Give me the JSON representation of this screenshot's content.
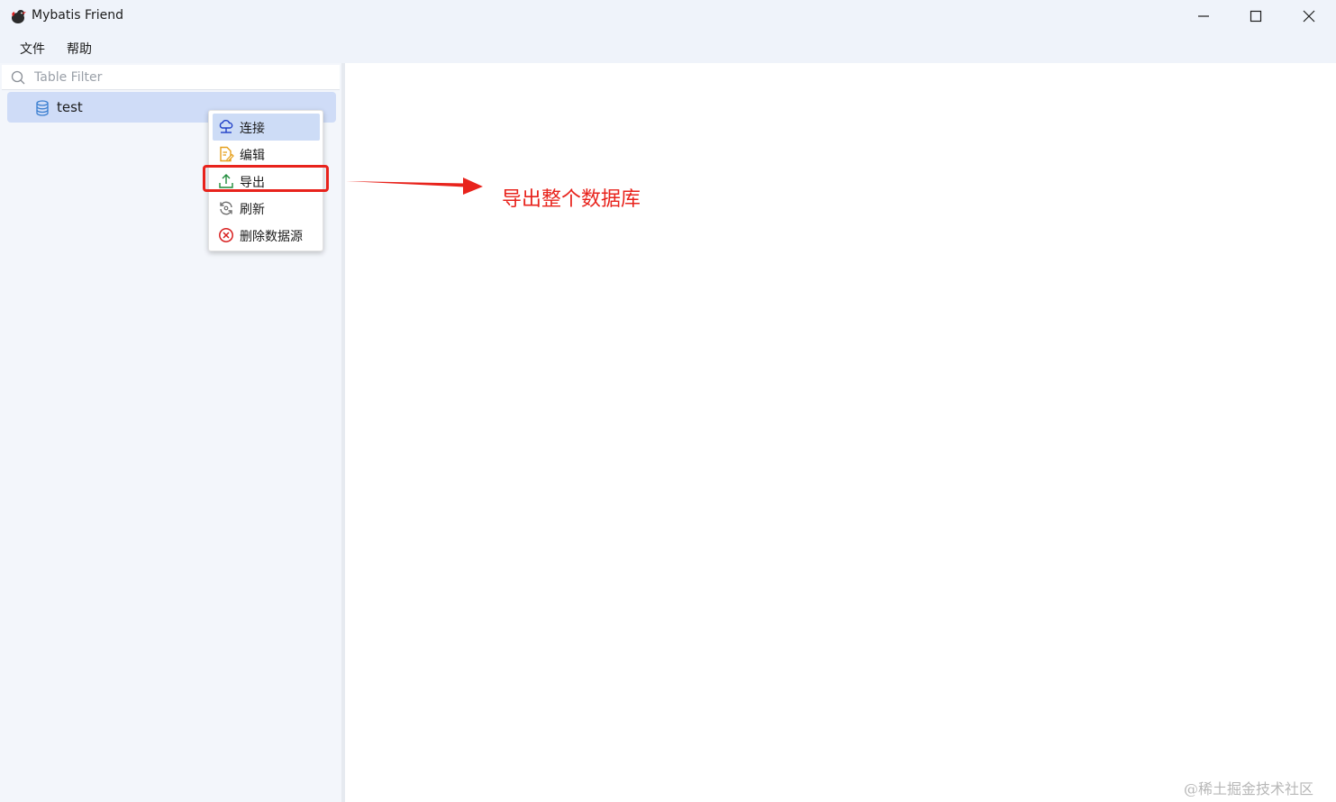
{
  "window": {
    "title": "Mybatis Friend",
    "icon": "bird-app-icon",
    "controls": [
      "minimize-icon",
      "maximize-icon",
      "close-icon"
    ]
  },
  "menubar": {
    "items": [
      {
        "label": "文件"
      },
      {
        "label": "帮助"
      }
    ]
  },
  "sidebar": {
    "filter": {
      "placeholder": "Table Filter",
      "value": ""
    },
    "tree": [
      {
        "label": "test",
        "icon": "database-icon",
        "selected": true
      }
    ]
  },
  "context_menu": {
    "items": [
      {
        "label": "连接",
        "icon": "cloud-connect-icon",
        "highlighted": true
      },
      {
        "label": "编辑",
        "icon": "edit-document-icon"
      },
      {
        "label": "导出",
        "icon": "upload-export-icon"
      },
      {
        "label": "刷新",
        "icon": "refresh-icon"
      },
      {
        "label": "删除数据源",
        "icon": "delete-circle-icon"
      }
    ]
  },
  "annotation": {
    "text": "导出整个数据库",
    "color": "#e8231c"
  },
  "watermark": "@稀土掘金技术社区",
  "colors": {
    "accent": "#cfdcf7",
    "annotation_red": "#e8231c"
  }
}
